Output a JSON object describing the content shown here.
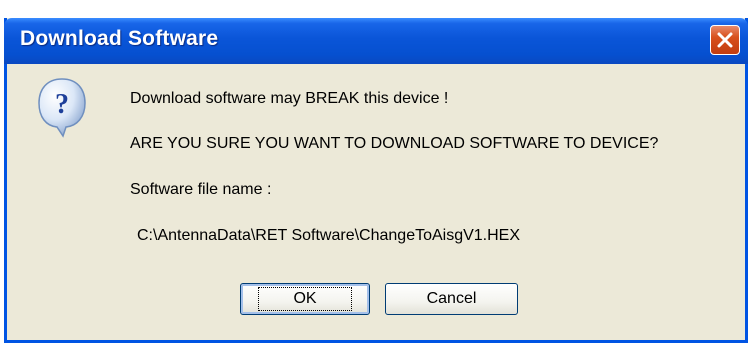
{
  "dialog": {
    "title": "Download Software",
    "messages": {
      "line1": "Download software may BREAK this device !",
      "line2": "ARE YOU SURE YOU WANT TO DOWNLOAD SOFTWARE TO DEVICE?",
      "line3": "Software file name :",
      "line4": "C:\\AntennaData\\RET Software\\ChangeToAisgV1.HEX"
    },
    "buttons": {
      "ok_label": "OK",
      "cancel_label": "Cancel"
    },
    "icons": {
      "question": "question-icon",
      "close": "close-icon"
    },
    "colors": {
      "titlebar": "#0a55d8",
      "close_button": "#d8501c",
      "window_body": "#ece9d8"
    }
  }
}
